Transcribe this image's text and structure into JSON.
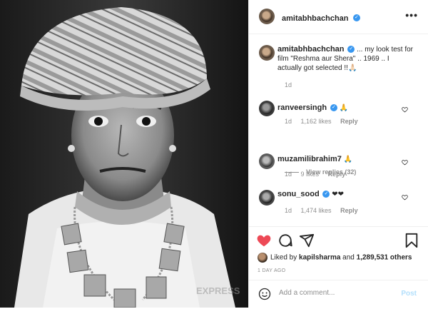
{
  "post": {
    "author": "amitabhbachchan",
    "verified_mark": "✓",
    "more_label": "•••",
    "watermark": "EXPRESS"
  },
  "caption": {
    "author": "amitabhbachchan",
    "text": "... my look test for film \"Reshma aur Shera\" .. 1969 .. I actually got selected !!🙏🏻",
    "time": "1d"
  },
  "comments": [
    {
      "user": "ranveersingh",
      "verified": true,
      "text": "🙏",
      "time": "1d",
      "likes": "1,162 likes",
      "reply": "Reply"
    },
    {
      "user": "muzamilibrahim7",
      "verified": false,
      "text": "🙏",
      "time": "1d",
      "likes": "9 likes",
      "reply": "Reply"
    },
    {
      "user": "sonu_sood",
      "verified": true,
      "text": "❤❤",
      "time": "1d",
      "likes": "1,474 likes",
      "reply": "Reply"
    }
  ],
  "view_replies": "View replies (32)",
  "actions": {
    "liked": true,
    "like_icon": "heart-filled-icon",
    "comment_icon": "comment-icon",
    "share_icon": "share-icon",
    "save_icon": "bookmark-icon"
  },
  "likes": {
    "prefix": "Liked by ",
    "user": "kapilsharma",
    "middle": " and ",
    "count": "1,289,531 others"
  },
  "time_ago": "1 DAY AGO",
  "add_comment": {
    "placeholder": "Add a comment...",
    "post_label": "Post",
    "emoji_icon": "emoji-icon"
  },
  "colors": {
    "heart": "#ed4956",
    "verified": "#3897f0",
    "post_disabled": "#b2dffc"
  }
}
